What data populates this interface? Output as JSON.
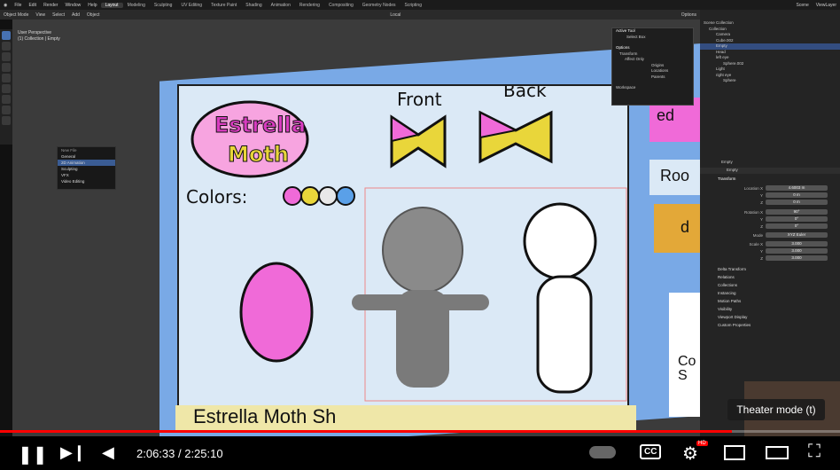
{
  "menu": [
    "File",
    "Edit",
    "Render",
    "Window",
    "Help"
  ],
  "workspaces": [
    "Layout",
    "Modeling",
    "Sculpting",
    "UV Editing",
    "Texture Paint",
    "Shading",
    "Animation",
    "Rendering",
    "Compositing",
    "Geometry Nodes",
    "Scripting"
  ],
  "scene": "Scene",
  "viewlayer": "ViewLayer",
  "header": {
    "mode": "Object Mode",
    "view": "View",
    "select": "Select",
    "add": "Add",
    "object": "Object",
    "transform": "Local",
    "options": "Options"
  },
  "viewport": {
    "line1": "User Perspective",
    "line2": "(1) Collection | Empty"
  },
  "canvas": {
    "title1": "Estrella",
    "title2": "Moth",
    "front": "Front",
    "back": "Back",
    "colors": "Colors:",
    "bottom": "Estrella Moth Sh",
    "right1": "ed",
    "right2": "Roo",
    "right3": "d",
    "right4": "Co",
    "right5": "S"
  },
  "context_menu": {
    "title": "New File",
    "items": [
      "General",
      "2D Animation",
      "Sculpting",
      "VFX",
      "Video Editing"
    ]
  },
  "npanel": {
    "active_tool": "Active Tool",
    "select_box": "Select Box",
    "options": "Options",
    "transform": "Transform",
    "affect_only": "Affect Only",
    "origins": "Origins",
    "locations": "Locations",
    "parents": "Parents",
    "workspace": "Workspace"
  },
  "outliner": {
    "scene_collection": "Scene Collection",
    "items": [
      "Collection",
      "Camera",
      "Cube.002",
      "Empty",
      "Head",
      "left eye",
      "Sphere.002",
      "Light",
      "right eye",
      "Sphere"
    ]
  },
  "props": {
    "object": "Empty",
    "name": "Empty",
    "transform": "Transform",
    "fields": [
      {
        "label": "Location X",
        "value": "4.6003 m"
      },
      {
        "label": "Y",
        "value": "0 m"
      },
      {
        "label": "Z",
        "value": "0 m"
      },
      {
        "label": "Rotation X",
        "value": "90°"
      },
      {
        "label": "Y",
        "value": "0°"
      },
      {
        "label": "Z",
        "value": "0°"
      },
      {
        "label": "Mode",
        "value": "XYZ Euler"
      },
      {
        "label": "Scale X",
        "value": "3.000"
      },
      {
        "label": "Y",
        "value": "3.000"
      },
      {
        "label": "Z",
        "value": "3.000"
      }
    ],
    "sections": [
      "Delta Transform",
      "Relations",
      "Collections",
      "Instancing",
      "Motion Paths",
      "Visibility",
      "Viewport Display",
      "Custom Properties"
    ]
  },
  "player": {
    "time": "2:06:33 / 2:25:10",
    "tooltip": "Theater mode (t)",
    "progress": 0.871,
    "hd": "HD"
  },
  "accent": "#ff0000"
}
